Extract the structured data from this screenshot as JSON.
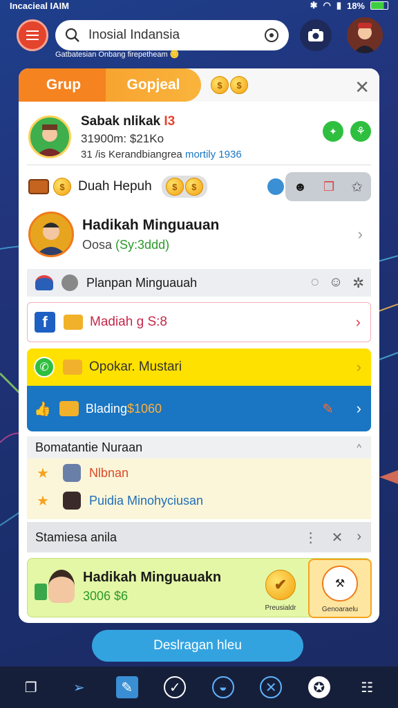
{
  "status_bar": {
    "carrier": "Incacieal IAIM",
    "battery": "18%"
  },
  "search": {
    "value": "Inosial Indansia"
  },
  "tagline": "Gatbatesian Onbang firepetheam",
  "tabs": [
    {
      "label": "Grup"
    },
    {
      "label": "Gopjeal"
    }
  ],
  "profile": {
    "name": "Sabak nlikak",
    "name_suffix": "I3",
    "stat": "31900m: $21Ko",
    "line": "31 /is Kerandbiangrea",
    "line_highlight": "mortily 1936"
  },
  "duah_row": {
    "label": "Duah Hepuh"
  },
  "hadikah_row": {
    "title": "Hadikah Minguauan",
    "subtitle": "Oosa",
    "subtitle_value": "(Sy:3ddd)"
  },
  "planpan_row": {
    "label": "Planpan Minguauah"
  },
  "madiah_row": {
    "label": "Madiah g S:8"
  },
  "opokar_row": {
    "label": "Opokar. Mustari"
  },
  "blading_row": {
    "label": "Blading",
    "value": "$1060"
  },
  "section": {
    "title": "Bomatantie Nuraan",
    "items": [
      {
        "label": "Nlbnan"
      },
      {
        "label": "Puidia Minohyciusan"
      }
    ]
  },
  "stamiesa_row": {
    "label": "Stamiesa anila"
  },
  "promo": {
    "title": "Hadikah Minguauakn",
    "value": "3006 $6",
    "badge1_label": "Preusialdr",
    "badge2_label": "Genoaraelu"
  },
  "bottom_button": {
    "label": "Deslragan hleu"
  },
  "colors": {
    "orange": "#f5831f",
    "yellow": "#ffe100",
    "blue": "#1a75c2",
    "green_bg": "#e4f7a6"
  }
}
